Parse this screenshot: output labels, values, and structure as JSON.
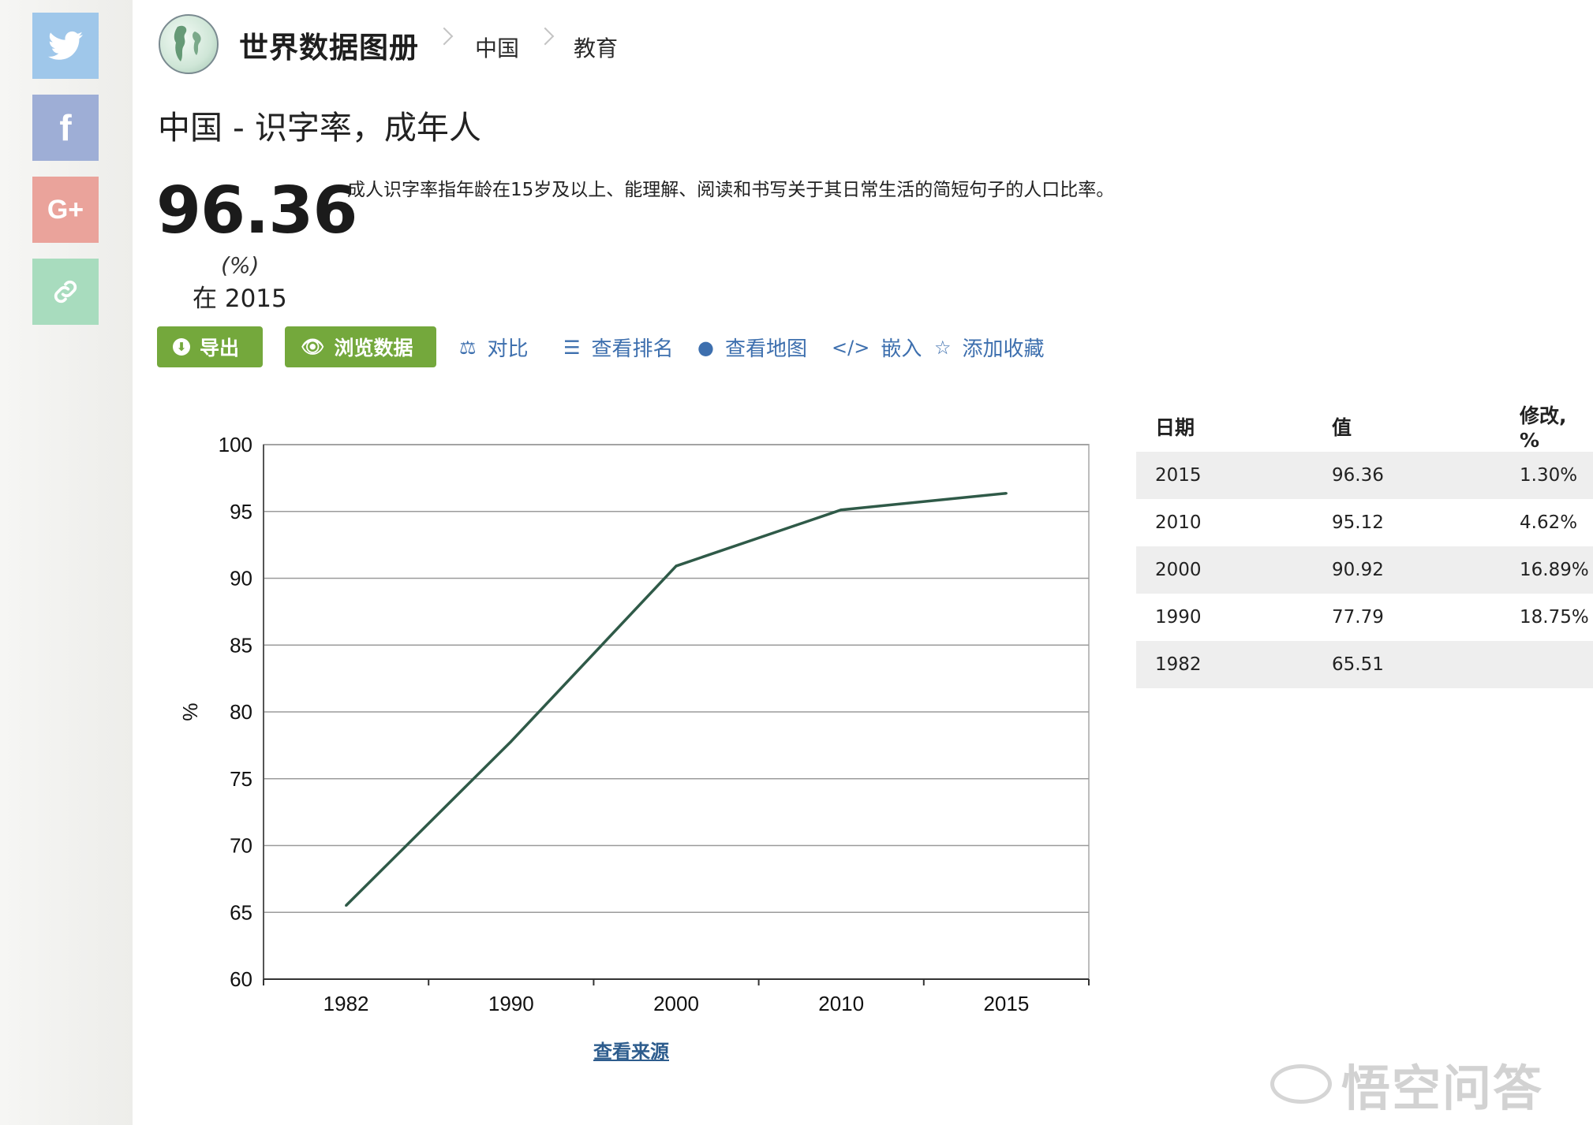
{
  "social": {
    "twitter": {
      "icon": "twitter-icon",
      "glyph": "🐦"
    },
    "facebook": {
      "icon": "facebook-icon",
      "glyph": "f"
    },
    "gplus": {
      "icon": "google-plus-icon",
      "glyph": "G+"
    },
    "link": {
      "icon": "link-icon",
      "glyph": "🔗"
    }
  },
  "header": {
    "brand": "世界数据图册",
    "breadcrumb": [
      "中国",
      "教育"
    ]
  },
  "page_title": "中国 - 识字率，成年人",
  "indicator": {
    "value": "96.36",
    "unit": "(%)",
    "year_text": "在 2015",
    "description": "成人识字率指年龄在15岁及以上、能理解、阅读和书写关于其日常生活的简短句子的人口比率。"
  },
  "actions": {
    "export": "导出",
    "browse": "浏览数据",
    "compare": "对比",
    "ranking": "查看排名",
    "map": "查看地图",
    "embed": "嵌入",
    "favorite": "添加收藏"
  },
  "table": {
    "headers": [
      "日期",
      "值",
      "修改, %"
    ],
    "rows": [
      [
        "2015",
        "96.36",
        "1.30%"
      ],
      [
        "2010",
        "95.12",
        "4.62%"
      ],
      [
        "2000",
        "90.92",
        "16.89%"
      ],
      [
        "1990",
        "77.79",
        "18.75%"
      ],
      [
        "1982",
        "65.51",
        ""
      ]
    ]
  },
  "source_link": "查看来源",
  "watermark": "悟空问答",
  "colors": {
    "line": "#2f5a48",
    "button_green": "#74a83c",
    "link_blue": "#3d6fae"
  },
  "chart_data": {
    "type": "line",
    "categories": [
      "1982",
      "1990",
      "2000",
      "2010",
      "2015"
    ],
    "series": [
      {
        "values": [
          65.51,
          77.79,
          90.92,
          95.12,
          96.36
        ]
      }
    ],
    "ylabel": "%",
    "ylim": [
      60,
      100
    ],
    "yticks": [
      60,
      65,
      70,
      75,
      80,
      85,
      90,
      95,
      100
    ],
    "grid": true
  }
}
